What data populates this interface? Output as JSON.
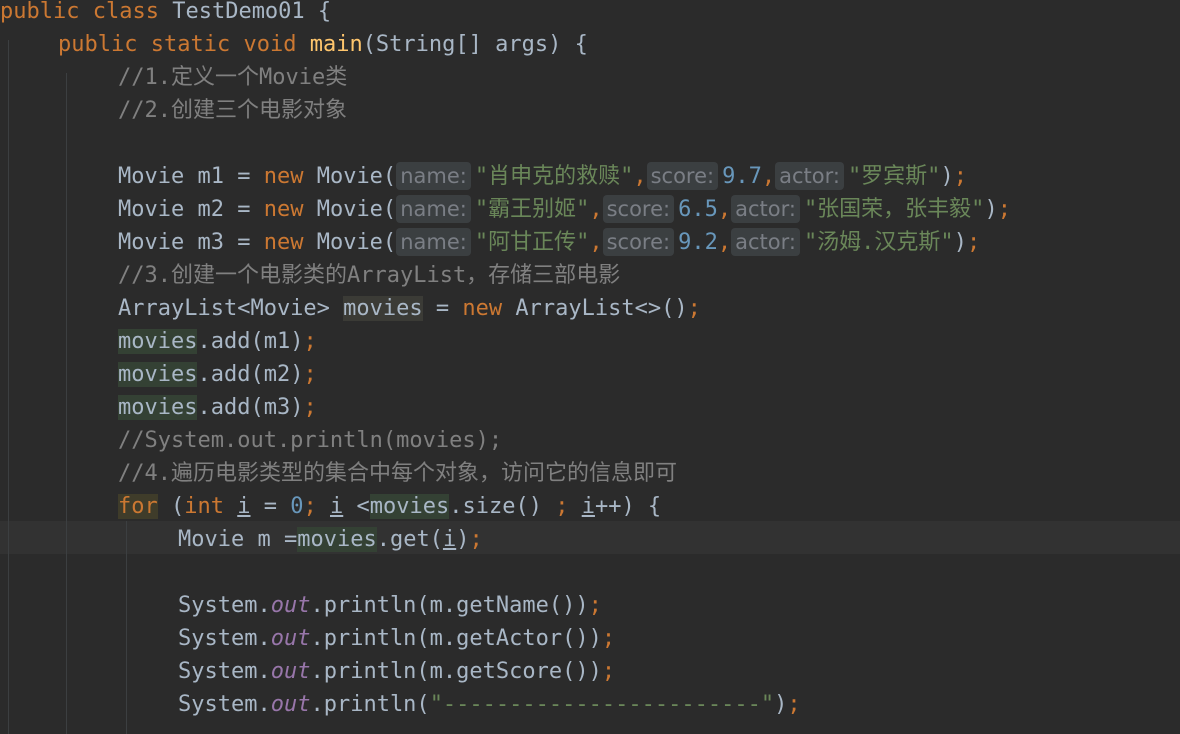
{
  "code": {
    "l1": {
      "kw_public": "public",
      "kw_class": "class",
      "class_name": "TestDemo01",
      "brace": " {"
    },
    "l2": {
      "kw_public": "public",
      "kw_static": "static",
      "kw_void": "void",
      "method": "main",
      "params": "(String[] args) {"
    },
    "l3": {
      "comment": "//1.定义一个Movie类"
    },
    "l4": {
      "comment": "//2.创建三个电影对象"
    },
    "movies": [
      {
        "decl": "Movie m1 = ",
        "ctor": "Movie(",
        "name_hint": "name:",
        "name_value": "\"肖申克的救赎\"",
        "score_hint": "score:",
        "score_value": "9.7",
        "actor_hint": "actor:",
        "actor_value": "\"罗宾斯\""
      },
      {
        "decl": "Movie m2 = ",
        "ctor": "Movie(",
        "name_hint": "name:",
        "name_value": "\"霸王别姬\"",
        "score_hint": "score:",
        "score_value": "6.5",
        "actor_hint": "actor:",
        "actor_value": "\"张国荣，张丰毅\""
      },
      {
        "decl": "Movie m3 = ",
        "ctor": "Movie(",
        "name_hint": "name:",
        "name_value": "\"阿甘正传\"",
        "score_hint": "score:",
        "score_value": "9.2",
        "actor_hint": "actor:",
        "actor_value": "\"汤姆.汉克斯\""
      }
    ],
    "kw_new": "new",
    "l8": {
      "comment": "//3.创建一个电影类的ArrayList，存储三部电影"
    },
    "l9": {
      "type": "ArrayList<Movie> ",
      "var": "movies",
      "assign": " = ",
      "ctor": "ArrayList<>()"
    },
    "adds": [
      {
        "var": "movies",
        "call": ".add(m1)"
      },
      {
        "var": "movies",
        "call": ".add(m2)"
      },
      {
        "var": "movies",
        "call": ".add(m3)"
      }
    ],
    "l13": {
      "comment": "//System.out.println(movies);"
    },
    "l14": {
      "comment": "//4.遍历电影类型的集合中每个对象，访问它的信息即可"
    },
    "l15": {
      "kw_for": "for",
      "open": " (",
      "kw_int": "int",
      "i": "i",
      "eq": " = ",
      "zero": "0",
      "semi": ";",
      "i2": "i",
      "lt": " <",
      "var": "movies",
      "size": ".size() ",
      "i3": "i",
      "inc": "++) {"
    },
    "l16": {
      "decl": "Movie m =",
      "var": "movies",
      "get": ".get(",
      "i": "i",
      "close": ")"
    },
    "prints": [
      {
        "sys": "System.",
        "out": "out",
        "call": ".println(m.getName())"
      },
      {
        "sys": "System.",
        "out": "out",
        "call": ".println(m.getActor())"
      },
      {
        "sys": "System.",
        "out": "out",
        "call": ".println(m.getScore())"
      },
      {
        "sys": "System.",
        "out": "out",
        "call_open": ".println(",
        "str": "\"------------------------\"",
        "call_close": ")"
      }
    ],
    "semicolon": ";",
    "comma": ","
  }
}
